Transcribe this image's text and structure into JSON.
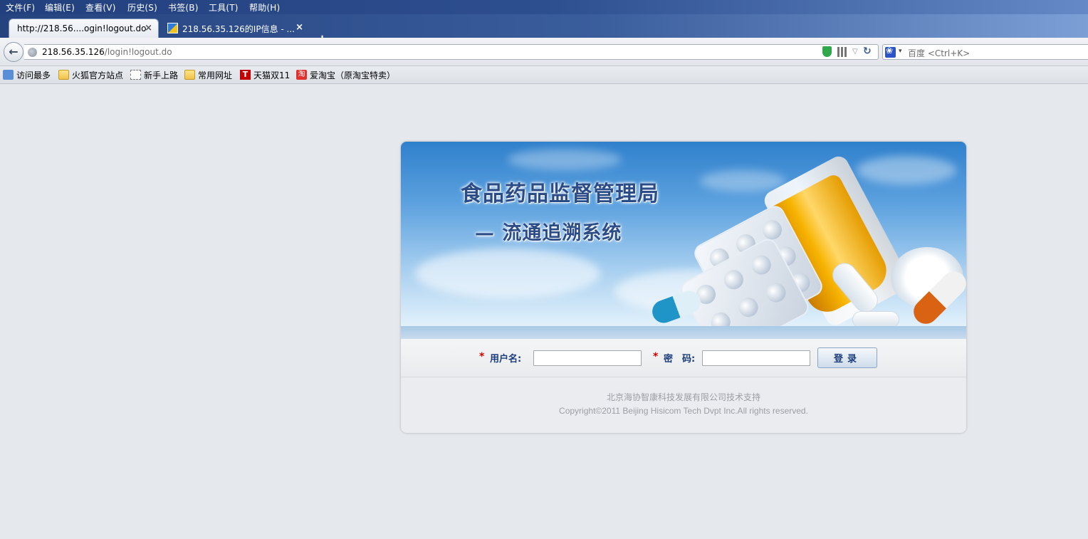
{
  "menu": [
    "文件(F)",
    "编辑(E)",
    "查看(V)",
    "历史(S)",
    "书签(B)",
    "工具(T)",
    "帮助(H)"
  ],
  "tabs": [
    {
      "title": "http://218.56....ogin!logout.do",
      "close": "×"
    },
    {
      "title": "218.56.35.126的IP信息 - ...",
      "close": "×"
    }
  ],
  "new_tab": "+",
  "urlbar": {
    "host": "218.56.35.126",
    "path": "/login!logout.do"
  },
  "search": {
    "placeholder": "百度 <Ctrl+K>"
  },
  "bookmarks": [
    "访问最多",
    "火狐官方站点",
    "新手上路",
    "常用网址",
    "天猫双11",
    "爱淘宝（原淘宝特卖）"
  ],
  "banner": {
    "title": "食品药品监督管理局",
    "subtitle": "— 流通追溯系统"
  },
  "login": {
    "username_label": "用户名:",
    "password_label": "密　码:",
    "required_mark": "*",
    "submit": "登录"
  },
  "footer": {
    "support": "北京海协智康科技发展有限公司技术支持",
    "copyright": "Copyright©2011 Beijing Hisicom Tech Dvpt Inc.All rights reserved."
  },
  "colors": {
    "accent": "#1c3d7c",
    "required": "#d40000",
    "page_bg": "#e5e8ec"
  }
}
